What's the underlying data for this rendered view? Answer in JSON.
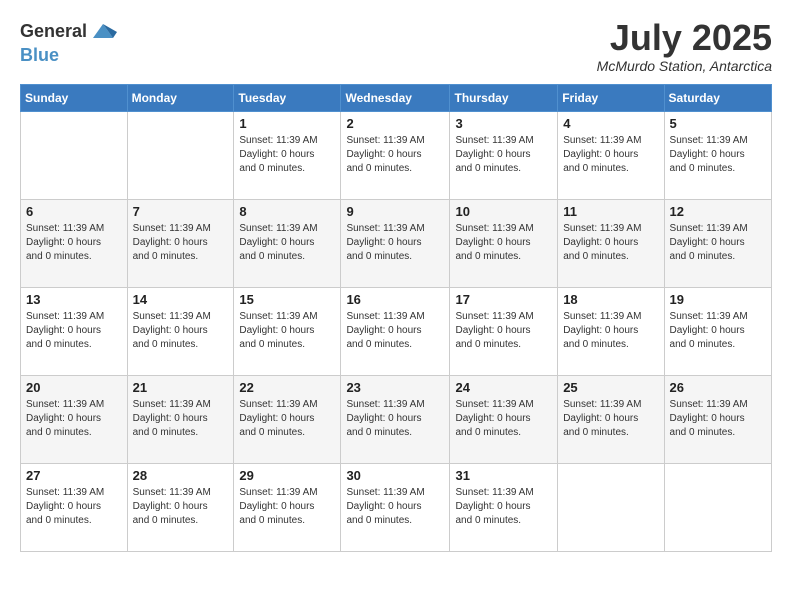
{
  "logo": {
    "line1": "General",
    "line2": "Blue"
  },
  "title": "July 2025",
  "location": "McMurdo Station, Antarctica",
  "days_of_week": [
    "Sunday",
    "Monday",
    "Tuesday",
    "Wednesday",
    "Thursday",
    "Friday",
    "Saturday"
  ],
  "day_info_text": "Sunset: 11:39 AM\nDaylight: 0 hours and 0 minutes.",
  "weeks": [
    [
      {
        "day": "",
        "info": ""
      },
      {
        "day": "",
        "info": ""
      },
      {
        "day": "1",
        "info": "Sunset: 11:39 AM\nDaylight: 0 hours\nand 0 minutes."
      },
      {
        "day": "2",
        "info": "Sunset: 11:39 AM\nDaylight: 0 hours\nand 0 minutes."
      },
      {
        "day": "3",
        "info": "Sunset: 11:39 AM\nDaylight: 0 hours\nand 0 minutes."
      },
      {
        "day": "4",
        "info": "Sunset: 11:39 AM\nDaylight: 0 hours\nand 0 minutes."
      },
      {
        "day": "5",
        "info": "Sunset: 11:39 AM\nDaylight: 0 hours\nand 0 minutes."
      }
    ],
    [
      {
        "day": "6",
        "info": "Sunset: 11:39 AM\nDaylight: 0 hours\nand 0 minutes."
      },
      {
        "day": "7",
        "info": "Sunset: 11:39 AM\nDaylight: 0 hours\nand 0 minutes."
      },
      {
        "day": "8",
        "info": "Sunset: 11:39 AM\nDaylight: 0 hours\nand 0 minutes."
      },
      {
        "day": "9",
        "info": "Sunset: 11:39 AM\nDaylight: 0 hours\nand 0 minutes."
      },
      {
        "day": "10",
        "info": "Sunset: 11:39 AM\nDaylight: 0 hours\nand 0 minutes."
      },
      {
        "day": "11",
        "info": "Sunset: 11:39 AM\nDaylight: 0 hours\nand 0 minutes."
      },
      {
        "day": "12",
        "info": "Sunset: 11:39 AM\nDaylight: 0 hours\nand 0 minutes."
      }
    ],
    [
      {
        "day": "13",
        "info": "Sunset: 11:39 AM\nDaylight: 0 hours\nand 0 minutes."
      },
      {
        "day": "14",
        "info": "Sunset: 11:39 AM\nDaylight: 0 hours\nand 0 minutes."
      },
      {
        "day": "15",
        "info": "Sunset: 11:39 AM\nDaylight: 0 hours\nand 0 minutes."
      },
      {
        "day": "16",
        "info": "Sunset: 11:39 AM\nDaylight: 0 hours\nand 0 minutes."
      },
      {
        "day": "17",
        "info": "Sunset: 11:39 AM\nDaylight: 0 hours\nand 0 minutes."
      },
      {
        "day": "18",
        "info": "Sunset: 11:39 AM\nDaylight: 0 hours\nand 0 minutes."
      },
      {
        "day": "19",
        "info": "Sunset: 11:39 AM\nDaylight: 0 hours\nand 0 minutes."
      }
    ],
    [
      {
        "day": "20",
        "info": "Sunset: 11:39 AM\nDaylight: 0 hours\nand 0 minutes."
      },
      {
        "day": "21",
        "info": "Sunset: 11:39 AM\nDaylight: 0 hours\nand 0 minutes."
      },
      {
        "day": "22",
        "info": "Sunset: 11:39 AM\nDaylight: 0 hours\nand 0 minutes."
      },
      {
        "day": "23",
        "info": "Sunset: 11:39 AM\nDaylight: 0 hours\nand 0 minutes."
      },
      {
        "day": "24",
        "info": "Sunset: 11:39 AM\nDaylight: 0 hours\nand 0 minutes."
      },
      {
        "day": "25",
        "info": "Sunset: 11:39 AM\nDaylight: 0 hours\nand 0 minutes."
      },
      {
        "day": "26",
        "info": "Sunset: 11:39 AM\nDaylight: 0 hours\nand 0 minutes."
      }
    ],
    [
      {
        "day": "27",
        "info": "Sunset: 11:39 AM\nDaylight: 0 hours\nand 0 minutes."
      },
      {
        "day": "28",
        "info": "Sunset: 11:39 AM\nDaylight: 0 hours\nand 0 minutes."
      },
      {
        "day": "29",
        "info": "Sunset: 11:39 AM\nDaylight: 0 hours\nand 0 minutes."
      },
      {
        "day": "30",
        "info": "Sunset: 11:39 AM\nDaylight: 0 hours\nand 0 minutes."
      },
      {
        "day": "31",
        "info": "Sunset: 11:39 AM\nDaylight: 0 hours\nand 0 minutes."
      },
      {
        "day": "",
        "info": ""
      },
      {
        "day": "",
        "info": ""
      }
    ]
  ]
}
